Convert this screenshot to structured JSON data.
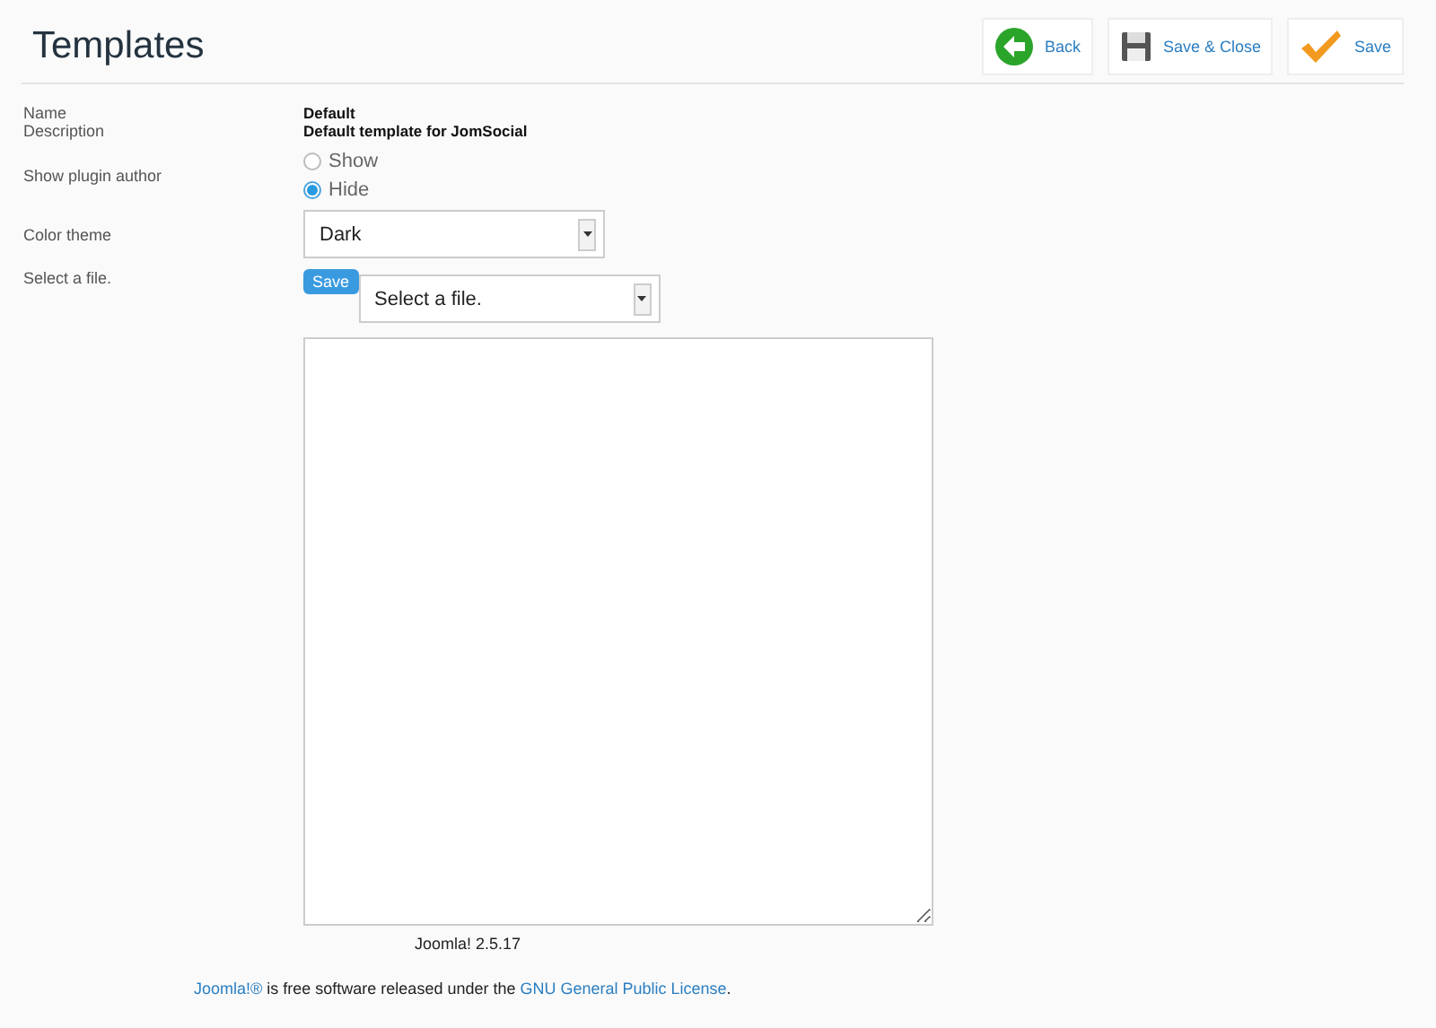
{
  "header": {
    "title": "Templates"
  },
  "toolbar": [
    {
      "kind": "back",
      "label": "Back"
    },
    {
      "kind": "save_close",
      "label": "Save & Close"
    },
    {
      "kind": "save",
      "label": "Save"
    }
  ],
  "form": {
    "name_label": "Name",
    "name_value": "Default",
    "description_label": "Description",
    "description_value": "Default template for JomSocial",
    "author_label": "Show plugin author",
    "author_options": [
      {
        "label": "Show",
        "selected": false
      },
      {
        "label": "Hide",
        "selected": true
      }
    ],
    "theme_label": "Color theme",
    "theme_value": "Dark",
    "file_label": "Select a file.",
    "file_save_button": "Save",
    "file_select_value": "Select a file."
  },
  "version": "Joomla! 2.5.17",
  "footer": {
    "link": "Joomla!®",
    "text": " is free software released under the ",
    "license_link": "GNU General Public License",
    "end": "."
  }
}
